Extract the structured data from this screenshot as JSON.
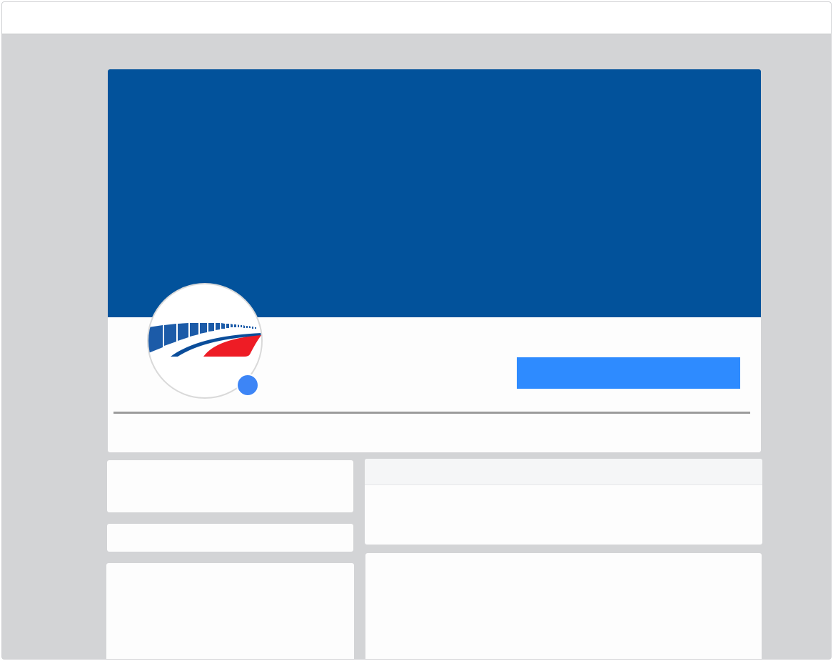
{
  "theme": {
    "page_background": "#d3d4d6",
    "cover_color": "#02529b",
    "accent_button": "#2e8bff",
    "status_dot": "#3d85f6"
  },
  "logo": {
    "icon": "train-logo-icon",
    "colors": {
      "primary": "#1c5ba8",
      "secondary": "#0a4d9a",
      "highlight": "#ee1c25"
    }
  },
  "profile": {
    "status_icon": "online-status-icon"
  }
}
